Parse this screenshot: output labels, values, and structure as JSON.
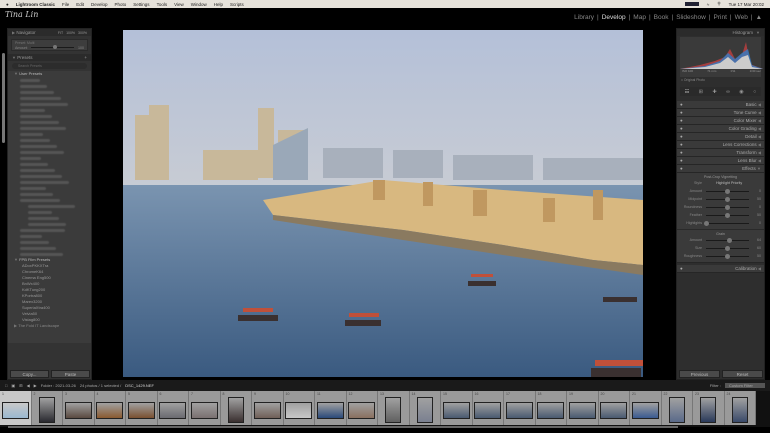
{
  "menubar": {
    "app": "Lightroom Classic",
    "items": [
      "File",
      "Edit",
      "Develop",
      "Photo",
      "Settings",
      "Tools",
      "View",
      "Window",
      "Help",
      "Scripts"
    ],
    "clock": "Tue 17 Mar 20:02"
  },
  "header": {
    "logo": "Tina Lin",
    "modules": [
      "Library",
      "Develop",
      "Map",
      "Book",
      "Slideshow",
      "Print",
      "Web"
    ],
    "active": "Develop"
  },
  "left": {
    "navigator": {
      "title": "Navigator",
      "zoom": [
        "FIT",
        "100%",
        "300%"
      ]
    },
    "preset_amount": {
      "label": "Preset: Multi",
      "amount_label": "Amount",
      "value": "100"
    },
    "presets": {
      "title": "Presets",
      "search_placeholder": "Search Presets",
      "user_group": "User Presets",
      "film_group": "FPB Film Presets",
      "film_items": [
        "ADoxPKKXTra",
        "ChromeK64",
        "Cinema Eng500",
        "BnWx400",
        "KdKTung200",
        "KPortra800",
        "Marex3200",
        "SuperiaXtra400",
        "Velvia50",
        "Vistag800"
      ],
      "next_group": "The Fold IT Landscape"
    },
    "copy": "Copy...",
    "paste": "Paste"
  },
  "right": {
    "histogram": {
      "title": "Histogram",
      "info": [
        "ISO 100",
        "71 mm",
        "f/11",
        "1/30 sec"
      ],
      "original": "Original Photo"
    },
    "panels": [
      "Basic",
      "Tone Curve",
      "Color Mixer",
      "Color Grading",
      "Detail",
      "Lens Corrections",
      "Transform",
      "Lens Blur"
    ],
    "effects": {
      "title": "Effects",
      "vignette_title": "Post-Crop Vignetting",
      "style_label": "Style",
      "style_value": "Highlight Priority",
      "vignette": [
        {
          "label": "Amount",
          "value": "0",
          "pos": 0.5
        },
        {
          "label": "Midpoint",
          "value": "50",
          "pos": 0.5
        },
        {
          "label": "Roundness",
          "value": "0",
          "pos": 0.5
        },
        {
          "label": "Feather",
          "value": "50",
          "pos": 0.5
        },
        {
          "label": "Highlights",
          "value": "0",
          "pos": 0.0
        }
      ],
      "grain_title": "Grain",
      "grain": [
        {
          "label": "Amount",
          "value": "64",
          "pos": 0.55
        },
        {
          "label": "Size",
          "value": "60",
          "pos": 0.5
        },
        {
          "label": "Roughness",
          "value": "50",
          "pos": 0.5
        }
      ]
    },
    "calibration": "Calibration",
    "previous": "Previous",
    "reset": "Reset"
  },
  "filmstrip": {
    "folder": "Folder : 2021-03-26",
    "count": "24 photos / 1 selected /",
    "file": "DSC_1429.NEF",
    "filter_label": "Filter :",
    "filter_value": "Custom Filter",
    "thumbs": [
      {
        "n": "1",
        "c": "#9ab8d0",
        "p": false,
        "sel": true
      },
      {
        "n": "2",
        "c": "#2a2a30",
        "p": true
      },
      {
        "n": "3",
        "c": "#5a4a40",
        "p": false
      },
      {
        "n": "4",
        "c": "#8a5a30",
        "p": false
      },
      {
        "n": "5",
        "c": "#7a5030",
        "p": false
      },
      {
        "n": "6",
        "c": "#6a6a70",
        "p": false
      },
      {
        "n": "7",
        "c": "#7a7070",
        "p": false
      },
      {
        "n": "8",
        "c": "#3a3030",
        "p": true
      },
      {
        "n": "9",
        "c": "#706058",
        "p": false
      },
      {
        "n": "10",
        "c": "#c8c8c8",
        "p": false
      },
      {
        "n": "11",
        "c": "#2a4a7a",
        "p": false
      },
      {
        "n": "12",
        "c": "#8a7060",
        "p": false
      },
      {
        "n": "13",
        "c": "#606060",
        "p": true
      },
      {
        "n": "14",
        "c": "#7a8090",
        "p": true
      },
      {
        "n": "15",
        "c": "#4a5a70",
        "p": false
      },
      {
        "n": "16",
        "c": "#4a5a70",
        "p": false
      },
      {
        "n": "17",
        "c": "#4a5a70",
        "p": false
      },
      {
        "n": "18",
        "c": "#4a5a70",
        "p": false
      },
      {
        "n": "19",
        "c": "#4a5a70",
        "p": false
      },
      {
        "n": "20",
        "c": "#4a5a70",
        "p": false
      },
      {
        "n": "21",
        "c": "#3a5a90",
        "p": false
      },
      {
        "n": "22",
        "c": "#5a6a8a",
        "p": true
      },
      {
        "n": "23",
        "c": "#2a3a5a",
        "p": true
      },
      {
        "n": "24",
        "c": "#3a4a6a",
        "p": true
      }
    ]
  }
}
